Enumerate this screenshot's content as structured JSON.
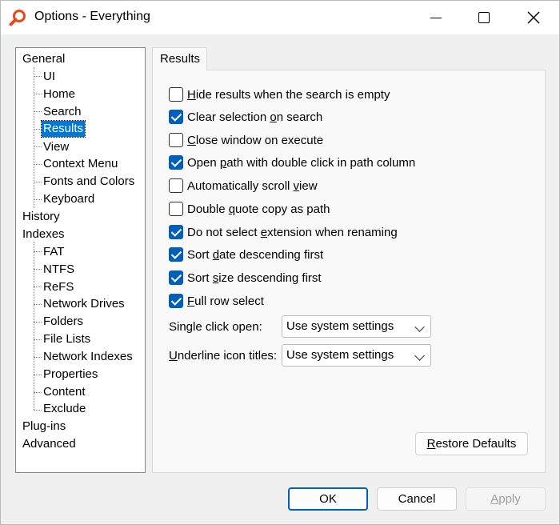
{
  "window": {
    "title": "Options - Everything"
  },
  "tree": {
    "items": [
      {
        "label": "General"
      },
      {
        "label": "UI"
      },
      {
        "label": "Home"
      },
      {
        "label": "Search"
      },
      {
        "label": "Results"
      },
      {
        "label": "View"
      },
      {
        "label": "Context Menu"
      },
      {
        "label": "Fonts and Colors"
      },
      {
        "label": "Keyboard"
      },
      {
        "label": "History"
      },
      {
        "label": "Indexes"
      },
      {
        "label": "FAT"
      },
      {
        "label": "NTFS"
      },
      {
        "label": "ReFS"
      },
      {
        "label": "Network Drives"
      },
      {
        "label": "Folders"
      },
      {
        "label": "File Lists"
      },
      {
        "label": "Network Indexes"
      },
      {
        "label": "Properties"
      },
      {
        "label": "Content"
      },
      {
        "label": "Exclude"
      },
      {
        "label": "Plug-ins"
      },
      {
        "label": "Advanced"
      }
    ],
    "selected": "Results"
  },
  "tab": {
    "label": "Results"
  },
  "options": [
    {
      "pre": "",
      "key": "H",
      "post": "ide results when the search is empty",
      "checked": false
    },
    {
      "pre": "Clear selection ",
      "key": "o",
      "post": "n search",
      "checked": true
    },
    {
      "pre": "",
      "key": "C",
      "post": "lose window on execute",
      "checked": false
    },
    {
      "pre": "Open ",
      "key": "p",
      "post": "ath with double click in path column",
      "checked": true
    },
    {
      "pre": "Automatically scroll ",
      "key": "v",
      "post": "iew",
      "checked": false
    },
    {
      "pre": "Double ",
      "key": "q",
      "post": "uote copy as path",
      "checked": false
    },
    {
      "pre": "Do not select ",
      "key": "e",
      "post": "xtension when renaming",
      "checked": true
    },
    {
      "pre": "Sort ",
      "key": "d",
      "post": "ate descending first",
      "checked": true
    },
    {
      "pre": "Sort ",
      "key": "s",
      "post": "ize descending first",
      "checked": true
    },
    {
      "pre": "",
      "key": "F",
      "post": "ull row select",
      "checked": true
    }
  ],
  "fields": {
    "single_click": {
      "label": "Single click open:",
      "value": "Use system settings"
    },
    "underline": {
      "key": "U",
      "label_rest": "nderline icon titles:",
      "value": "Use system settings"
    }
  },
  "buttons": {
    "restore": {
      "key": "R",
      "rest": "estore Defaults"
    },
    "ok": "OK",
    "cancel": "Cancel",
    "apply": {
      "key": "A",
      "rest": "pply"
    }
  },
  "colors": {
    "accent": "#005fb8",
    "selection": "#0078d7"
  }
}
